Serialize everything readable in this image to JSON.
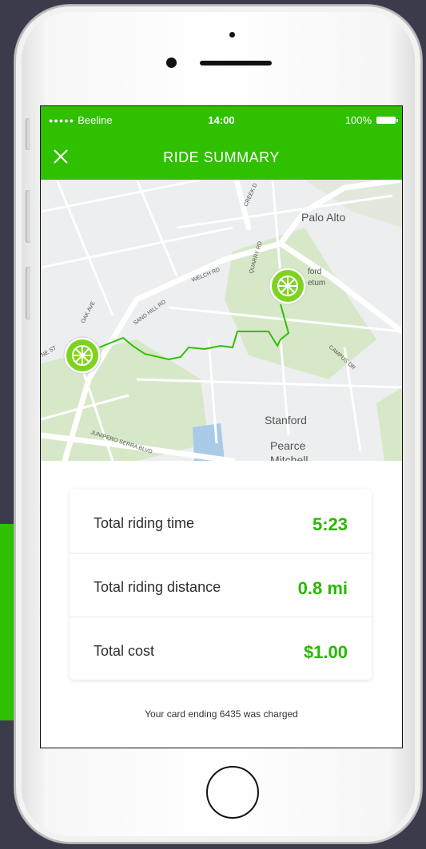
{
  "colors": {
    "brand_green": "#2fc000",
    "value_green": "#27b900",
    "background": "#3c3b4c"
  },
  "status_bar": {
    "carrier": "Beeline",
    "time": "14:00",
    "battery": "100%"
  },
  "nav": {
    "title": "RIDE SUMMARY",
    "close_icon": "close-icon"
  },
  "map": {
    "labels": {
      "palo_alto": "Palo Alto",
      "stanford": "Stanford",
      "pearce": "Pearce",
      "mitchell": "Mitchell",
      "arboretum_a": "ford",
      "arboretum_b": "etum"
    },
    "streets": {
      "oak_ave": "OAK AVE",
      "sand_hill": "SAND HILL RD",
      "welch": "WELCH RD",
      "quarry": "QUARRY RD",
      "creek": "CREEK D",
      "junipero": "JUNIPERO SERRA BLVD",
      "campus": "CAMPUS DR",
      "ne_st": "NE ST"
    },
    "start_marker_icon": "bike-wheel-icon",
    "end_marker_icon": "bike-wheel-icon"
  },
  "summary": {
    "rows": [
      {
        "label": "Total riding time",
        "value": "5:23"
      },
      {
        "label": "Total riding distance",
        "value": "0.8 mi"
      },
      {
        "label": "Total cost",
        "value": "$1.00"
      }
    ],
    "note": "Your card ending 6435 was charged"
  }
}
